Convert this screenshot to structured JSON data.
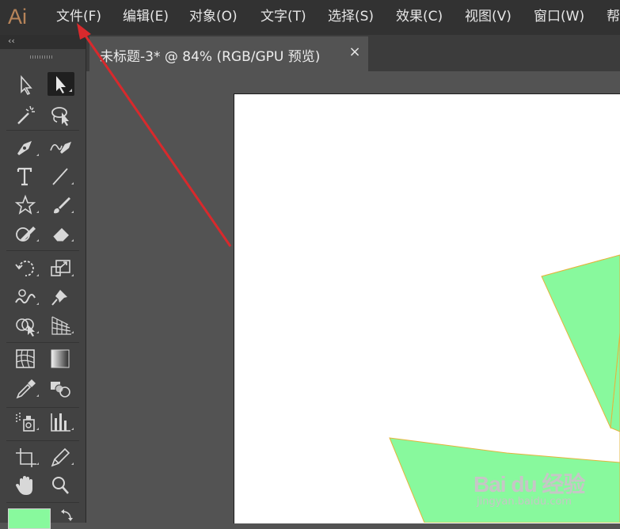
{
  "app": {
    "logo": "Ai",
    "brand_color": "#b7845a"
  },
  "menu": [
    "文件(F)",
    "编辑(E)",
    "对象(O)",
    "文字(T)",
    "选择(S)",
    "效果(C)",
    "视图(V)",
    "窗口(W)",
    "帮"
  ],
  "document_tab": {
    "title": "未标题-3* @ 84% (RGB/GPU 预览)",
    "close": "×"
  },
  "toolbar": {
    "collapse": "‹‹",
    "tools": [
      "selection-tool",
      "direct-selection-tool",
      "magic-wand-tool",
      "lasso-tool",
      "pen-tool",
      "curvature-tool",
      "type-tool",
      "line-segment-tool",
      "star-tool",
      "paintbrush-tool",
      "shaper-tool",
      "eraser-tool",
      "rotate-tool",
      "scale-tool",
      "warp-tool",
      "puppet-warp-tool",
      "shape-builder-tool",
      "perspective-grid-tool",
      "mesh-tool",
      "gradient-tool",
      "eyedropper-tool",
      "blend-tool",
      "symbol-sprayer-tool",
      "column-graph-tool",
      "artboard-tool",
      "slice-tool",
      "hand-tool",
      "zoom-tool"
    ],
    "fill_color": "#88f99d"
  },
  "artwork": {
    "shape_fill": "#88f99d",
    "shape_stroke": "#e6b43c",
    "annotation_arrow_color": "#d8292c"
  },
  "watermark": {
    "logo": "Bai du 经验",
    "url": "jingyan.baidu.com"
  }
}
